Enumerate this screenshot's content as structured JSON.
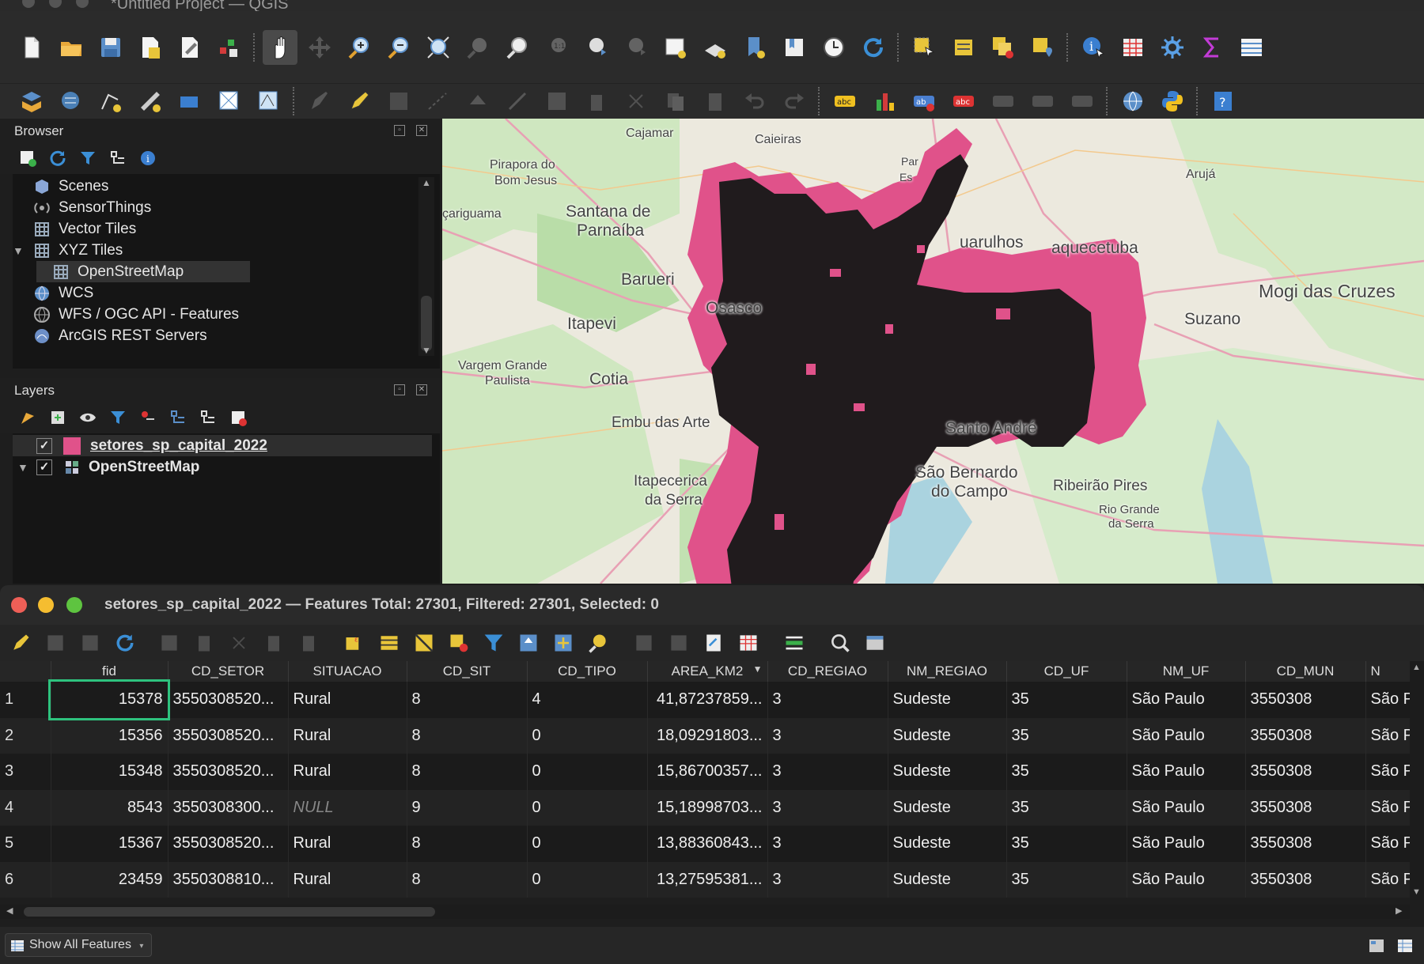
{
  "window": {
    "title": "*Untitled Project — QGIS"
  },
  "browser": {
    "title": "Browser",
    "items": [
      {
        "label": "Scenes",
        "icon": "scenes-icon"
      },
      {
        "label": "SensorThings",
        "icon": "sensorthings-icon"
      },
      {
        "label": "Vector Tiles",
        "icon": "grid-icon"
      },
      {
        "label": "XYZ Tiles",
        "icon": "grid-icon"
      },
      {
        "label": "OpenStreetMap",
        "icon": "grid-icon"
      },
      {
        "label": "WCS",
        "icon": "globe-icon"
      },
      {
        "label": "WFS / OGC API - Features",
        "icon": "globe-icon"
      },
      {
        "label": "ArcGIS REST Servers",
        "icon": "arcgis-icon"
      }
    ]
  },
  "layers": {
    "title": "Layers",
    "items": [
      {
        "label": "setores_sp_capital_2022",
        "checked": true,
        "color": "#e0528a"
      },
      {
        "label": "OpenStreetMap",
        "checked": true
      }
    ]
  },
  "map": {
    "labels": [
      "Cajamar",
      "Caieiras",
      "Pirapora do",
      "Bom Jesus",
      "Santana de",
      "Parnaíba",
      "çariguama",
      "Arujá",
      "uarulhos",
      "aquecetuba",
      "Barueri",
      "Osasco",
      "Itapevi",
      "Mogi das Cruzes",
      "Suzano",
      "Vargem Grande",
      "Paulista",
      "Cotia",
      "Embu das Arte",
      "Santo André",
      "São Bernardo",
      "do Campo",
      "Ribeirão Pires",
      "Rio Grande",
      "da Serra",
      "Itapecerica",
      "da Serra",
      "Par",
      "Es"
    ],
    "polygon_color": "#e0528a"
  },
  "attribute_table": {
    "title": "setores_sp_capital_2022 — Features Total: 27301, Filtered: 27301, Selected: 0",
    "columns": [
      "fid",
      "CD_SETOR",
      "SITUACAO",
      "CD_SIT",
      "CD_TIPO",
      "AREA_KM2",
      "CD_REGIAO",
      "NM_REGIAO",
      "CD_UF",
      "NM_UF",
      "CD_MUN",
      "N"
    ],
    "rows": [
      [
        "1",
        "15378",
        "3550308520...",
        "Rural",
        "8",
        "4",
        "41,87237859...",
        "3",
        "Sudeste",
        "35",
        "São Paulo",
        "3550308",
        "São P"
      ],
      [
        "2",
        "15356",
        "3550308520...",
        "Rural",
        "8",
        "0",
        "18,09291803...",
        "3",
        "Sudeste",
        "35",
        "São Paulo",
        "3550308",
        "São P"
      ],
      [
        "3",
        "15348",
        "3550308520...",
        "Rural",
        "8",
        "0",
        "15,86700357...",
        "3",
        "Sudeste",
        "35",
        "São Paulo",
        "3550308",
        "São P"
      ],
      [
        "4",
        "8543",
        "3550308300...",
        "NULL",
        "9",
        "0",
        "15,18998703...",
        "3",
        "Sudeste",
        "35",
        "São Paulo",
        "3550308",
        "São P"
      ],
      [
        "5",
        "15367",
        "3550308520...",
        "Rural",
        "8",
        "0",
        "13,88360843...",
        "3",
        "Sudeste",
        "35",
        "São Paulo",
        "3550308",
        "São P"
      ],
      [
        "6",
        "23459",
        "3550308810...",
        "Rural",
        "8",
        "0",
        "13,27595381...",
        "3",
        "Sudeste",
        "35",
        "São Paulo",
        "3550308",
        "São P"
      ]
    ],
    "show_features": "Show All Features"
  }
}
